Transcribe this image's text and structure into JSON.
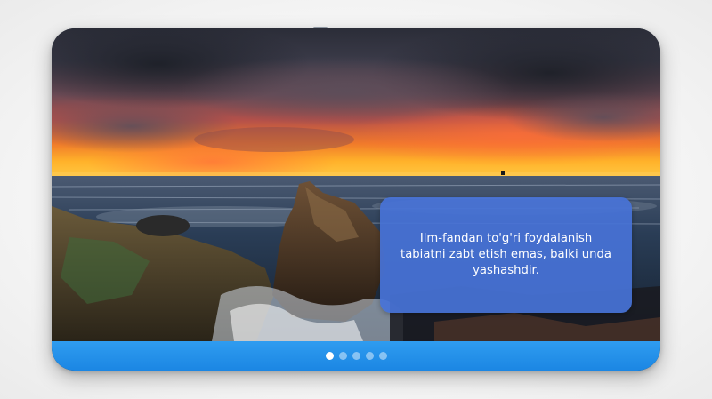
{
  "slider": {
    "quote": "Ilm-fandan to'g'ri foydalanish\ntabiatni zabt etish emas, balki unda\nyashashdir.",
    "slide_count": 5,
    "active_slide": 1,
    "background_scene": "sunset-sea-rocks-image"
  },
  "colors": {
    "quote_box": "#4772d6",
    "footer_bar": "#1b86e3",
    "dot_active": "#ffffff",
    "dot_inactive": "#ffffff73"
  }
}
